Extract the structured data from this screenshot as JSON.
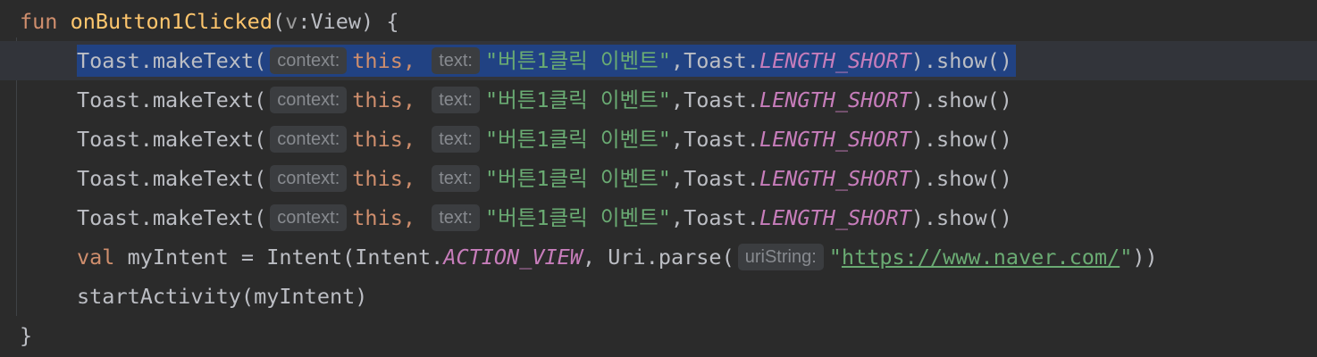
{
  "code": {
    "decl": {
      "keyword": "fun",
      "name": "onButton1Clicked",
      "open": "(",
      "param": "v",
      "colon": ":",
      "type": "View",
      "close": ") {"
    },
    "toast_lines": [
      {
        "receiver": "Toast.makeText(",
        "hint_context": "context:",
        "this_kw": "this,",
        "hint_text": "text:",
        "string": "\"버튼1클릭 이벤트\"",
        "after_string": ",Toast.",
        "constant": "LENGTH_SHORT",
        "tail": ").show()"
      },
      {
        "receiver": "Toast.makeText(",
        "hint_context": "context:",
        "this_kw": "this,",
        "hint_text": "text:",
        "string": "\"버튼1클릭 이벤트\"",
        "after_string": ",Toast.",
        "constant": "LENGTH_SHORT",
        "tail": ").show()"
      },
      {
        "receiver": "Toast.makeText(",
        "hint_context": "context:",
        "this_kw": "this,",
        "hint_text": "text:",
        "string": "\"버튼1클릭 이벤트\"",
        "after_string": ",Toast.",
        "constant": "LENGTH_SHORT",
        "tail": ").show()"
      },
      {
        "receiver": "Toast.makeText(",
        "hint_context": "context:",
        "this_kw": "this,",
        "hint_text": "text:",
        "string": "\"버튼1클릭 이벤트\"",
        "after_string": ",Toast.",
        "constant": "LENGTH_SHORT",
        "tail": ").show()"
      },
      {
        "receiver": "Toast.makeText(",
        "hint_context": "context:",
        "this_kw": "this,",
        "hint_text": "text:",
        "string": "\"버튼1클릭 이벤트\"",
        "after_string": ",Toast.",
        "constant": "LENGTH_SHORT",
        "tail": ").show()"
      }
    ],
    "intent_line": {
      "keyword": "val",
      "pre": " myIntent = Intent(Intent.",
      "constant": "ACTION_VIEW",
      "mid": ", Uri.parse(",
      "hint": "uriString:",
      "quote_open": "\"",
      "url": "https://www.naver.com/",
      "quote_close": "\"",
      "tail": "))"
    },
    "start_line": "startActivity(myIntent)",
    "closing_brace": "}"
  },
  "colors": {
    "background": "#2b2b2b",
    "selection": "#214283",
    "keyword": "#cf8e6d",
    "function_decl": "#ffc66d",
    "string": "#6aab73",
    "constant": "#c77dbb",
    "text": "#bcbec4"
  }
}
